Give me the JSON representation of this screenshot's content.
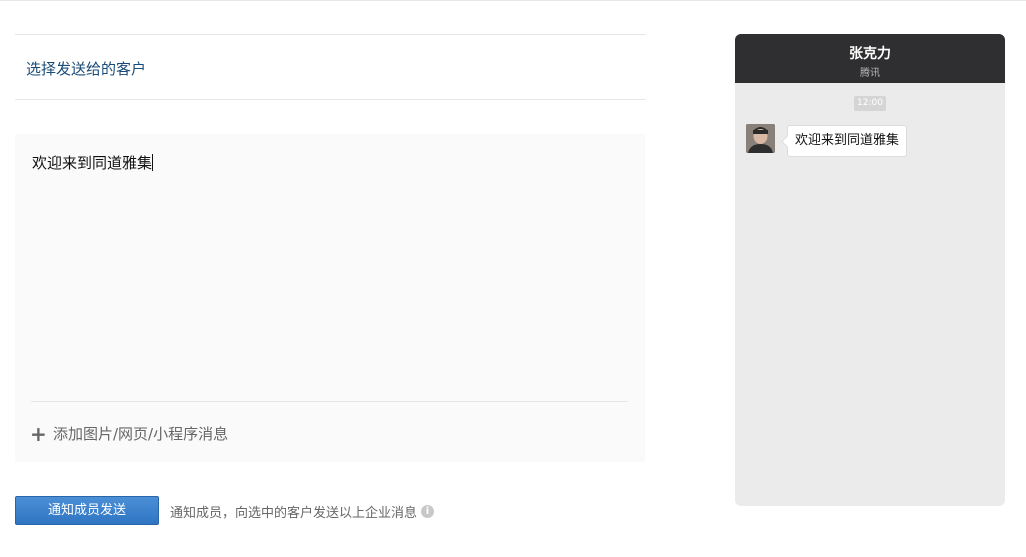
{
  "recipients": {
    "select_label": "选择发送给的客户"
  },
  "editor": {
    "message_text": "欢迎来到同道雅集",
    "add_attachment_label": "添加图片/网页/小程序消息",
    "add_icon": "plus-icon"
  },
  "actions": {
    "notify_button_label": "通知成员发送",
    "notify_description": "通知成员，向选中的客户发送以上企业消息",
    "info_icon": "info-icon"
  },
  "preview": {
    "contact_name": "张克力",
    "contact_company": "腾讯",
    "time": "12:00",
    "message": "欢迎来到同道雅集",
    "header_color": "#2f2f31"
  },
  "colors": {
    "accent": "#2f75c2",
    "link": "#1a4a78"
  }
}
